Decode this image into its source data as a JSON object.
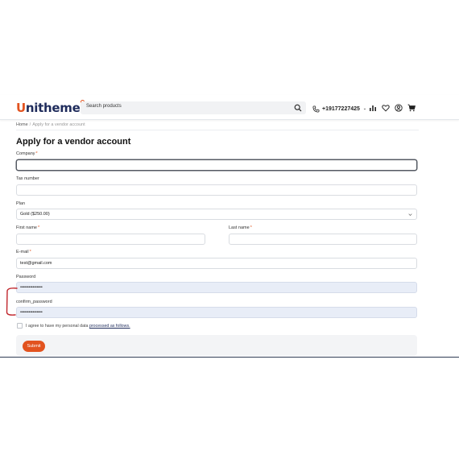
{
  "header": {
    "logo_u": "U",
    "logo_rest": "nitheme",
    "search_placeholder": "Search products",
    "phone": "+19177227425",
    "icons": [
      "search-icon",
      "phone-icon",
      "chart-icon",
      "heart-icon",
      "user-icon",
      "cart-icon"
    ]
  },
  "breadcrumb": {
    "home": "Home",
    "separator": "/",
    "current": "Apply for a vendor account"
  },
  "form": {
    "title": "Apply for a vendor account",
    "company": {
      "label": "Company",
      "value": ""
    },
    "tax_number": {
      "label": "Tax number",
      "value": ""
    },
    "plan": {
      "label": "Plan",
      "value": "Gold ($250.00)"
    },
    "first_name": {
      "label": "First name",
      "value": ""
    },
    "last_name": {
      "label": "Last name",
      "value": ""
    },
    "email": {
      "label": "E-mail",
      "value": "test@gmail.com"
    },
    "password": {
      "label": "Password",
      "value": "••••••••••••••••"
    },
    "confirm_password": {
      "label": "confirm_password",
      "value": "••••••••••••••••"
    },
    "required_marker": "*",
    "agree_text": "I agree to have my personal data",
    "agree_link": "processed as follows.",
    "submit_label": "Submit"
  },
  "colors": {
    "accent": "#e2531f",
    "brand_dark": "#1f2c5c",
    "autofill_bg": "#e8edf7",
    "annotation": "#c0262d"
  }
}
